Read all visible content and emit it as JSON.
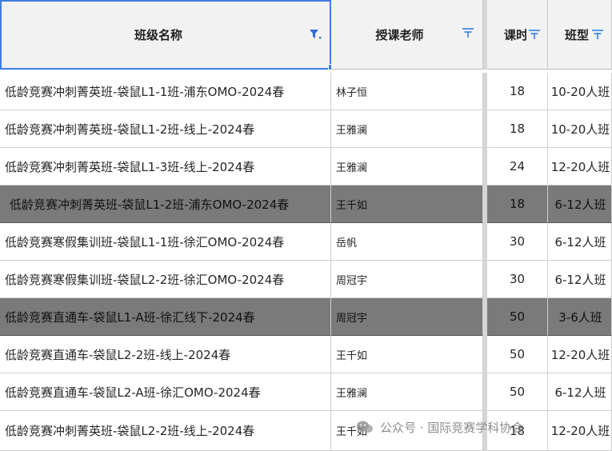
{
  "columns": [
    {
      "label": "班级名称",
      "filter_icon": "filter-active-icon"
    },
    {
      "label": "授课老师",
      "filter_icon": "filter-icon"
    },
    {
      "label": "课时",
      "filter_icon": "filter-icon"
    },
    {
      "label": "班型",
      "filter_icon": "filter-icon"
    }
  ],
  "rows": [
    {
      "class_name": "低龄竞赛冲刺菁英班-袋鼠L1-1班-浦东OMO-2024春",
      "teacher": "林子恒",
      "hours": "18",
      "class_type": "10-20人班",
      "highlight": false
    },
    {
      "class_name": "低龄竞赛冲刺菁英班-袋鼠L1-2班-线上-2024春",
      "teacher": "王雅澜",
      "hours": "18",
      "class_type": "10-20人班",
      "highlight": false
    },
    {
      "class_name": "低龄竞赛冲刺菁英班-袋鼠L1-3班-线上-2024春",
      "teacher": "王雅澜",
      "hours": "24",
      "class_type": "12-20人班",
      "highlight": false
    },
    {
      "class_name": "低龄竞赛冲刺菁英班-袋鼠L1-2班-浦东OMO-2024春",
      "teacher": "王千如",
      "hours": "18",
      "class_type": "6-12人班",
      "highlight": true
    },
    {
      "class_name": "低龄竞赛寒假集训班-袋鼠L1-1班-徐汇OMO-2024春",
      "teacher": "岳帆",
      "hours": "30",
      "class_type": "6-12人班",
      "highlight": false
    },
    {
      "class_name": "低龄竞赛寒假集训班-袋鼠L2-2班-徐汇OMO-2024春",
      "teacher": "周冠宇",
      "hours": "30",
      "class_type": "6-12人班",
      "highlight": false
    },
    {
      "class_name": "低龄竞赛直通车-袋鼠L1-A班-徐汇线下-2024春",
      "teacher": "周冠宇",
      "hours": "50",
      "class_type": "3-6人班",
      "highlight": true
    },
    {
      "class_name": "低龄竞赛直通车-袋鼠L2-2班-线上-2024春",
      "teacher": "王千如",
      "hours": "50",
      "class_type": "12-20人班",
      "highlight": false
    },
    {
      "class_name": "低龄竞赛直通车-袋鼠L2-A班-徐汇OMO-2024春",
      "teacher": "王雅澜",
      "hours": "50",
      "class_type": "6-12人班",
      "highlight": false
    },
    {
      "class_name": "低龄竞赛冲刺菁英班-袋鼠L2-2班-线上-2024春",
      "teacher": "王千如",
      "hours": "18",
      "class_type": "12-20人班",
      "highlight": false
    }
  ],
  "watermark": {
    "text": "公众号 · 国际竞赛学科协会",
    "icon": "wechat-icon"
  },
  "colors": {
    "accent": "#3b7de0",
    "header_bg": "#f2f2f2",
    "highlight_row": "#7a7a7a",
    "grid_line": "#cfcfcf"
  }
}
